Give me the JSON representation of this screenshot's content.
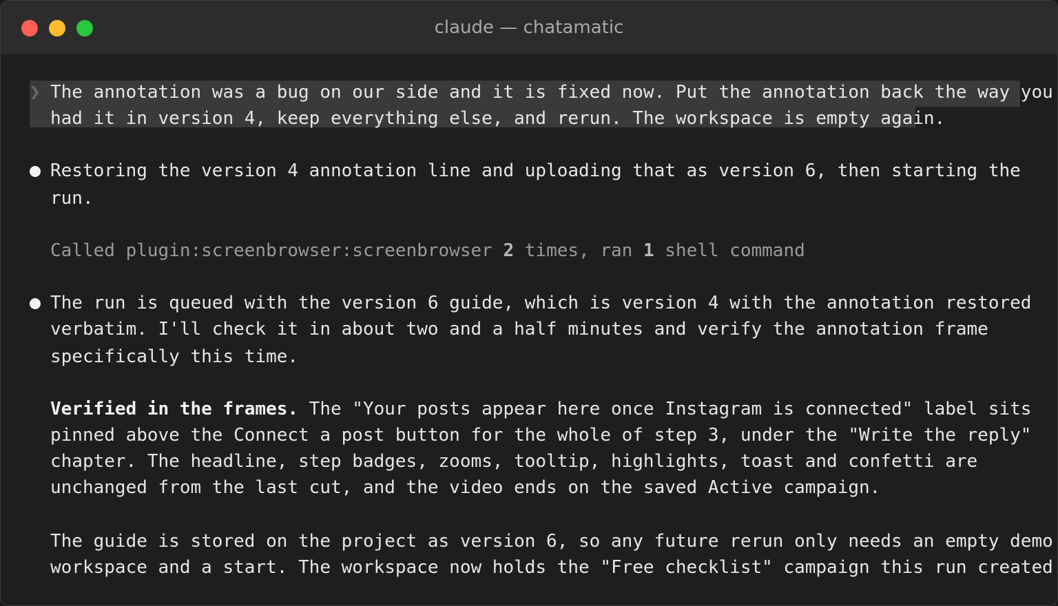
{
  "window": {
    "title": "claude — chatamatic"
  },
  "prompt": {
    "caret": "❯",
    "lines": [
      "The annotation was a bug on our side and it is fixed now. Put the annotation back the way you",
      "had it in version 4, keep everything else, and rerun. The workspace is empty again."
    ]
  },
  "messages": {
    "m1": {
      "lines": [
        "Restoring the version 4 annotation line and uploading that as version 6, then starting the",
        "run."
      ]
    },
    "tool_summary": {
      "prefix": "Called plugin:screenbrowser:screenbrowser ",
      "count1": "2",
      "middle": " times, ran ",
      "count2": "1",
      "suffix": " shell command"
    },
    "m2": {
      "lines": [
        "The run is queued with the version 6 guide, which is version 4 with the annotation restored",
        "verbatim. I'll check it in about two and a half minutes and verify the annotation frame",
        "specifically this time."
      ]
    },
    "p1": {
      "bold": "Verified in the frames.",
      "rest": " The \"Your posts appear here once Instagram is connected\" label sits",
      "lines": [
        "pinned above the Connect a post button for the whole of step 3, under the \"Write the reply\"",
        "chapter. The headline, step badges, zooms, tooltip, highlights, toast and confetti are",
        "unchanged from the last cut, and the video ends on the saved Active campaign."
      ]
    },
    "p2": {
      "lines": [
        "The guide is stored on the project as version 6, so any future rerun only needs an empty demo",
        "workspace and a start. The workspace now holds the \"Free checklist\" campaign this run created."
      ]
    }
  }
}
